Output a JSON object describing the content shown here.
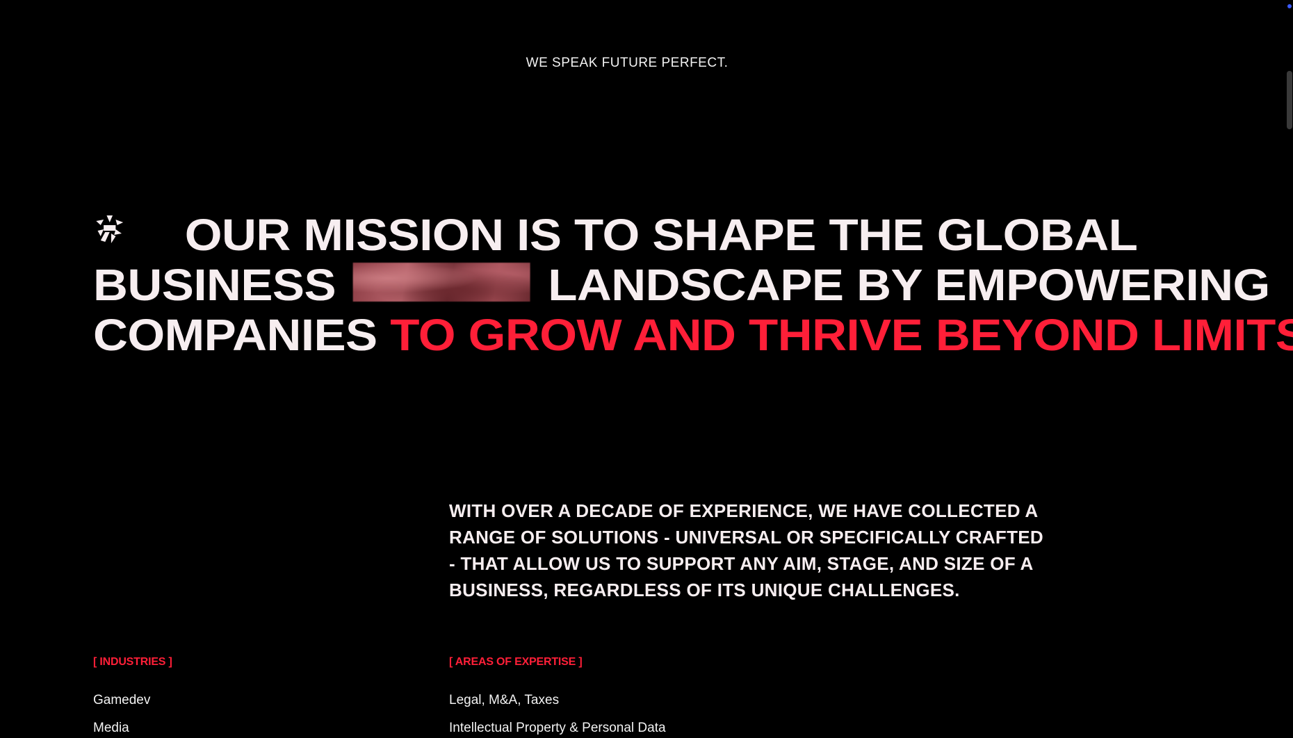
{
  "tagline": "WE SPEAK FUTURE PERFECT.",
  "mission": {
    "logo_icon": "asterisk-logo-icon",
    "part1": "OUR MISSION IS TO SHAPE THE GLOBAL BUSINESS",
    "part2": "LANDSCAPE BY EMPOWERING COMPANIES",
    "accent": "TO GROW AND THRIVE BEYOND LIMITS."
  },
  "statement": "WITH OVER A DECADE OF EXPERIENCE, WE HAVE COLLECTED A RANGE OF SOLUTIONS - UNIVERSAL OR SPECIFICALLY CRAFTED - THAT ALLOW US TO SUPPORT ANY AIM, STAGE, AND SIZE OF A BUSINESS, REGARDLESS OF ITS UNIQUE CHALLENGES.",
  "industries": {
    "label": "[ INDUSTRIES ]",
    "items": [
      "Gamedev",
      "Media"
    ]
  },
  "expertise": {
    "label": "[ AREAS OF EXPERTISE ]",
    "items": [
      "Legal, M&A, Taxes",
      "Intellectual Property & Personal Data"
    ]
  },
  "colors": {
    "background": "#000000",
    "text": "#f7eef0",
    "accent": "#ff1f38",
    "scroll_thumb": "#3a3a3a",
    "corner_dot": "#3b5bff"
  }
}
